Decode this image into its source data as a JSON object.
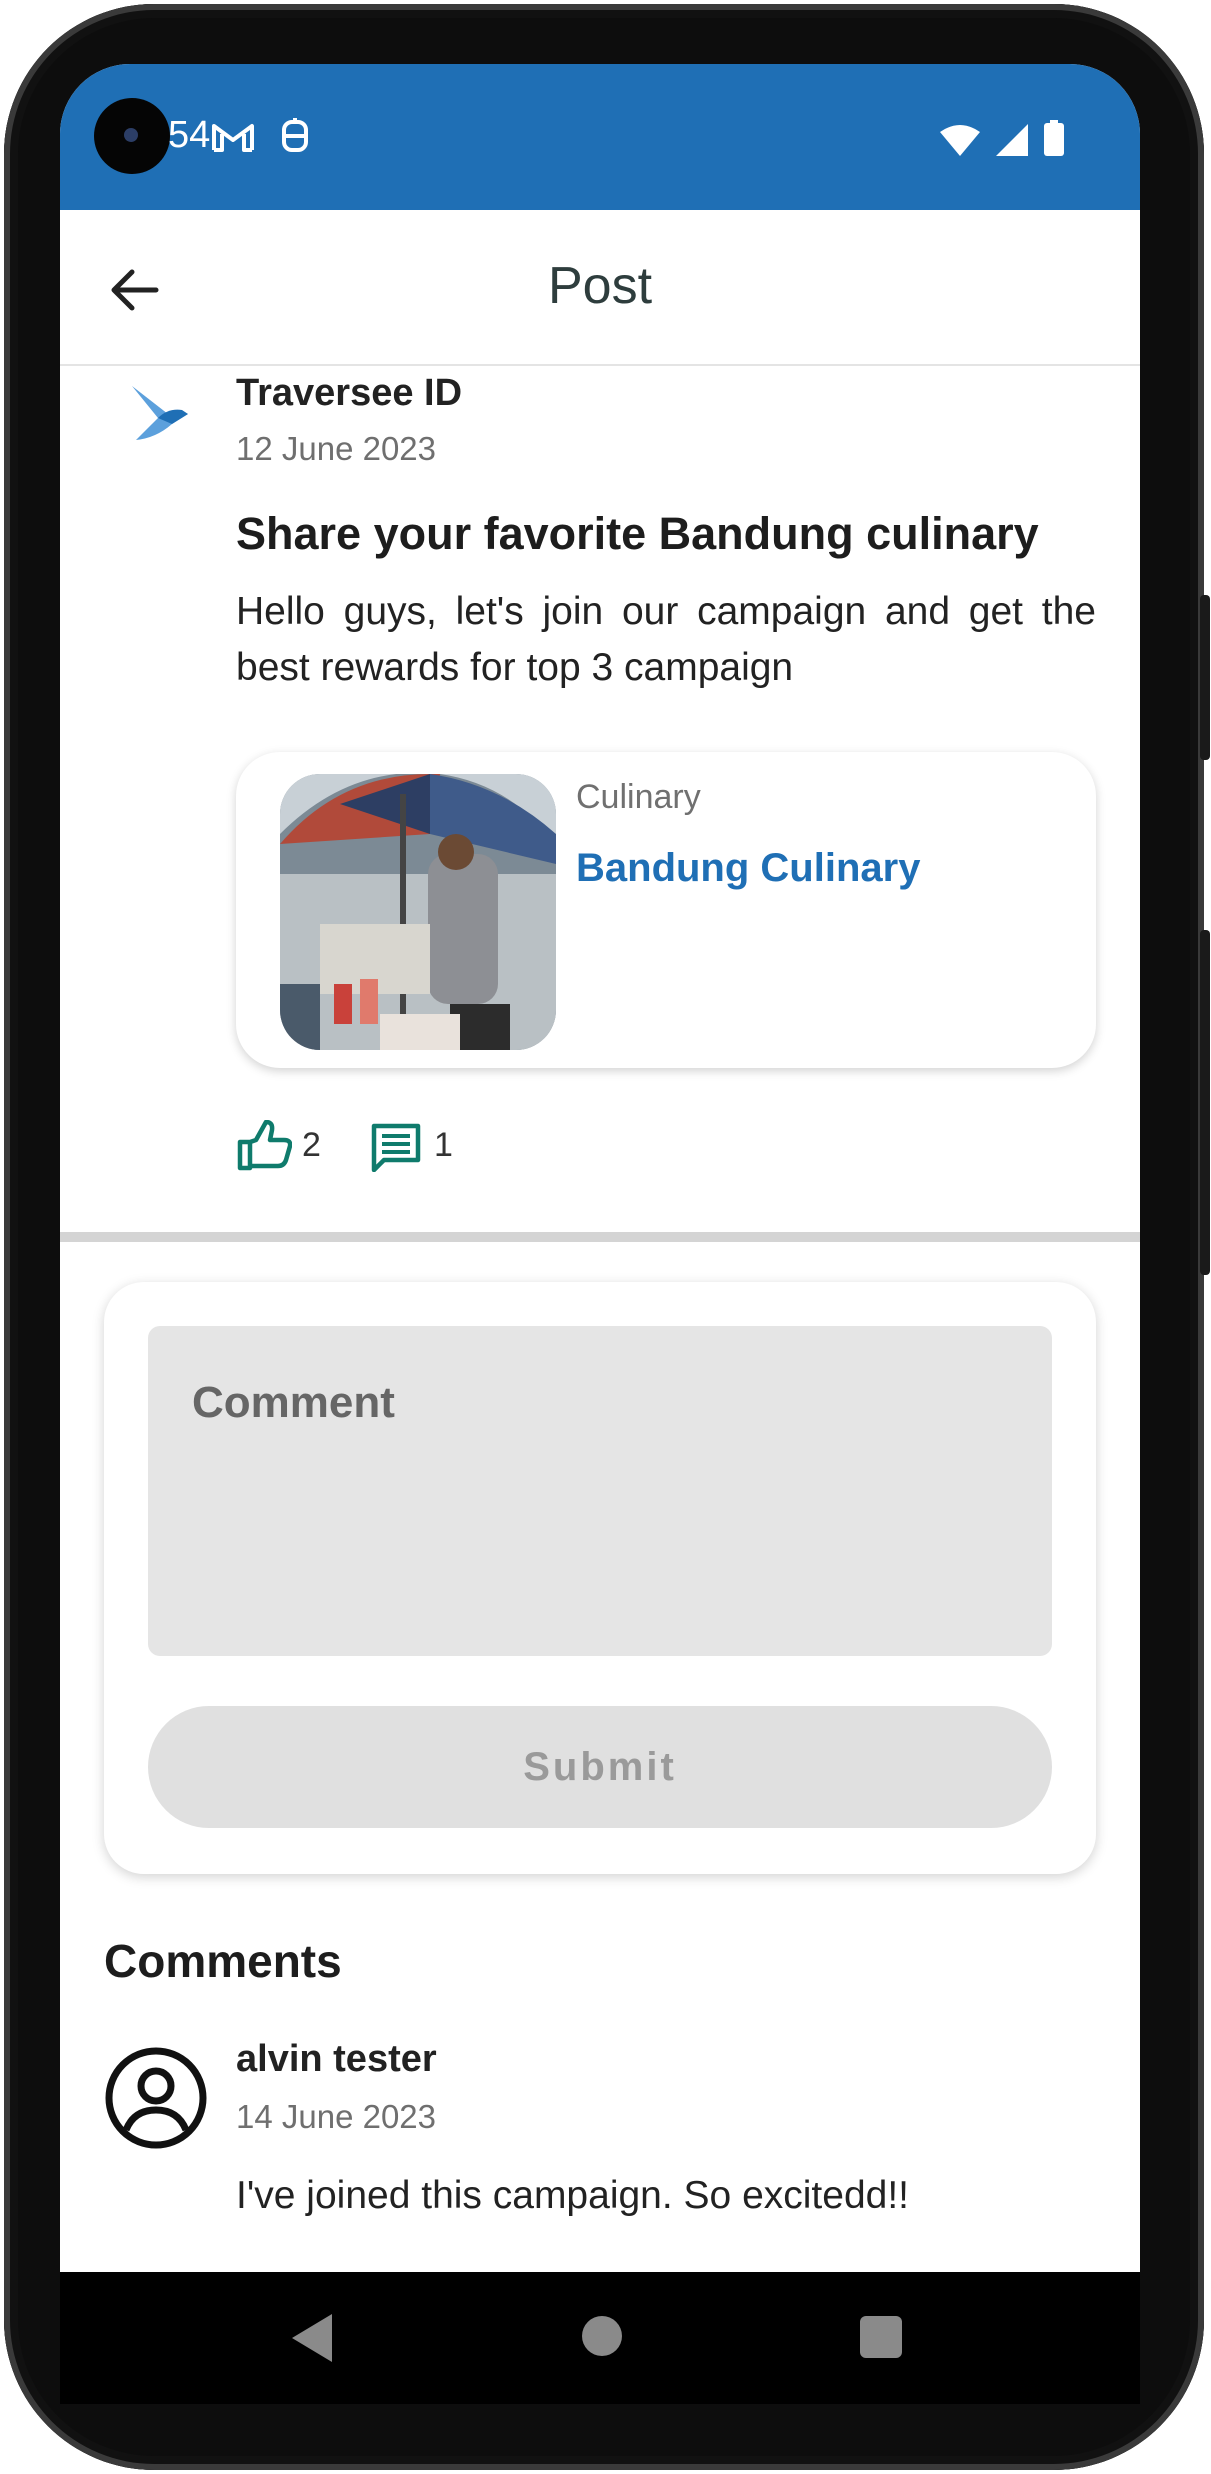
{
  "status_bar": {
    "time": "54",
    "icons": [
      "gmail-icon",
      "app-notification-icon",
      "wifi-icon",
      "cell-signal-icon",
      "battery-icon"
    ]
  },
  "app_bar": {
    "title": "Post",
    "back_icon": "arrow-left-icon"
  },
  "post": {
    "author": "Traversee ID",
    "date": "12 June 2023",
    "title": "Share your favorite Bandung culinary",
    "body": "Hello guys, let's join our campaign and get the best rewards for top 3 campaign",
    "campaign": {
      "category": "Culinary",
      "name": "Bandung Culinary"
    },
    "likes": "2",
    "comments": "1"
  },
  "comment_form": {
    "placeholder": "Comment",
    "submit_label": "Submit"
  },
  "comments_section": {
    "heading": "Comments",
    "items": [
      {
        "name": "alvin tester",
        "date": "14 June 2023",
        "text": "I've joined this campaign. So excitedd!!"
      }
    ]
  },
  "colors": {
    "status_bar": "#1f6fb5",
    "accent_link": "#1f6fb5",
    "icon_teal": "#0f7b6c"
  }
}
